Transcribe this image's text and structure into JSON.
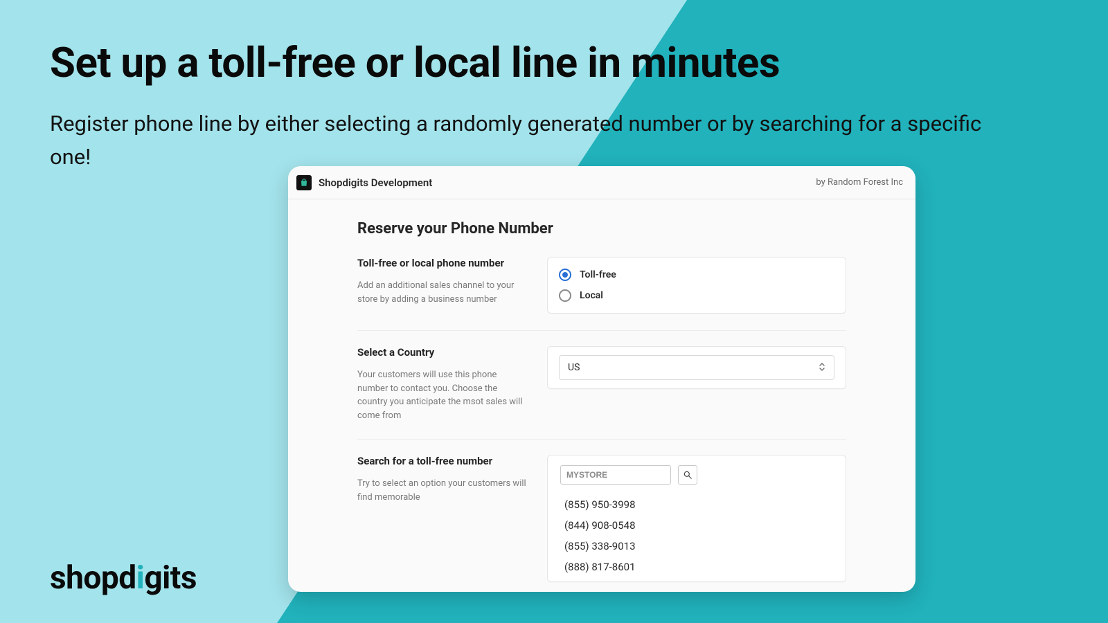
{
  "hero": {
    "title": "Set up a toll-free or local line in minutes",
    "subtitle": "Register phone line by either selecting a randomly generated number or by searching for a specific one!"
  },
  "brand": {
    "pre": "shopd",
    "accent": "i",
    "post": "gits"
  },
  "card": {
    "app_title": "Shopdigits Development",
    "by_line": "by Random Forest Inc",
    "title": "Reserve your Phone Number",
    "section_type": {
      "label": "Toll-free or local phone number",
      "desc": "Add an additional sales channel to your store by adding a business number",
      "options": {
        "toll_free": "Toll-free",
        "local": "Local"
      }
    },
    "section_country": {
      "label": "Select a Country",
      "desc": "Your customers will use this phone number to contact you. Choose the country you anticipate the msot sales will come from",
      "selected": "US"
    },
    "section_search": {
      "label": "Search for a toll-free number",
      "desc": "Try to select an option your customers will find memorable",
      "input_value": "MYSTORE",
      "results": [
        "(855) 950-3998",
        "(844) 908-0548",
        "(855) 338-9013",
        "(888) 817-8601"
      ]
    }
  }
}
